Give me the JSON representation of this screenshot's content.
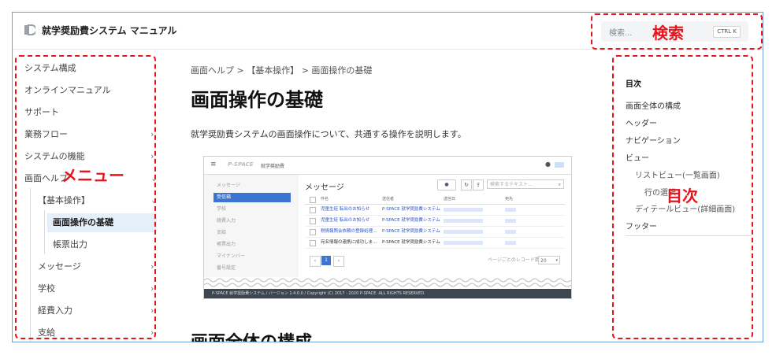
{
  "header": {
    "title": "就学奨励費システム マニュアル",
    "search_placeholder": "検索...",
    "search_shortcut": "CTRL  K"
  },
  "sidebar": {
    "items": [
      {
        "label": "システム構成"
      },
      {
        "label": "オンラインマニュアル"
      },
      {
        "label": "サポート"
      },
      {
        "label": "業務フロー"
      },
      {
        "label": "システムの機能"
      },
      {
        "label": "画面ヘルプ"
      },
      {
        "label": "【基本操作】"
      },
      {
        "label": "画面操作の基礎"
      },
      {
        "label": "帳票出力"
      },
      {
        "label": "メッセージ"
      },
      {
        "label": "学校"
      },
      {
        "label": "経費入力"
      },
      {
        "label": "支給"
      }
    ]
  },
  "content": {
    "breadcrumb": "画面ヘルプ > 【基本操作】 > 画面操作の基礎",
    "title": "画面操作の基礎",
    "description": "就学奨励費システムの画面操作について、共通する操作を説明します。",
    "section_title": "画面全体の構成"
  },
  "screenshot": {
    "app_logo": "P-SPACE",
    "app_name": "就学奨励費",
    "heading": "メッセージ",
    "search_placeholder": "検索するテキスト...",
    "side_items": [
      "メッセージ",
      "受信箱",
      "学校",
      "経費入力",
      "支給",
      "帳票出力",
      "マイナンバー",
      "番号設定"
    ],
    "columns": [
      "件名",
      "送信者",
      "送信日",
      "宛先"
    ],
    "rows": [
      {
        "subject": "児童生徒 転出のお知らせ",
        "sender": "P-SPACE 就学奨励費システム"
      },
      {
        "subject": "児童生徒 転出のお知らせ",
        "sender": "P-SPACE 就学奨励費システム"
      },
      {
        "subject": "税情報照会依頼の登録処理...",
        "sender": "P-SPACE 就学奨励費システム"
      },
      {
        "subject": "宛名情報の連携に成功しま...",
        "sender": "P-SPACE 就学奨励費システム"
      }
    ],
    "page_current": "1",
    "per_page_label": "ページごとのレコード数",
    "per_page_value": "20",
    "footer": "P-SPACE 就学奨励費システム / バージョン 1.4.0.0 / Copyright (C) 2017 - 2020 P-SPACE. ALL RIGHTS RESERVED."
  },
  "toc": {
    "heading": "目次",
    "items": [
      {
        "label": "画面全体の構成"
      },
      {
        "label": "ヘッダー"
      },
      {
        "label": "ナビゲーション"
      },
      {
        "label": "ビュー"
      },
      {
        "label": "リストビュー(一覧画面)"
      },
      {
        "label": "行の選択"
      },
      {
        "label": "ディテールビュー(詳細画面)"
      },
      {
        "label": "フッター"
      }
    ]
  },
  "annotations": {
    "search": "検索",
    "menu": "メニュー",
    "toc": "目次",
    "color": "#e8141b"
  }
}
